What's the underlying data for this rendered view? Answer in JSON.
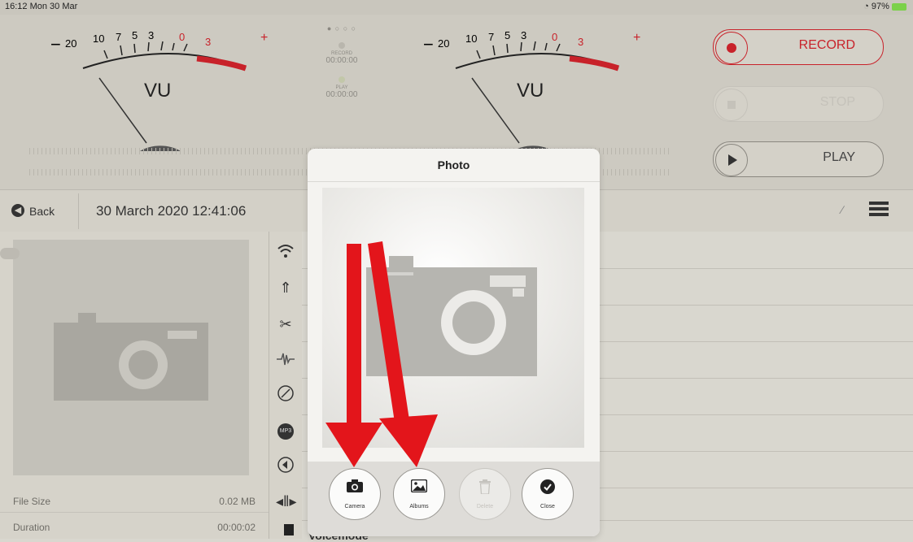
{
  "status_bar": {
    "time": "16:12  Mon 30 Mar",
    "battery": "97%"
  },
  "meters": {
    "left": {
      "minus": "−",
      "ticks": [
        "20",
        "10",
        "7",
        "5",
        "3",
        "0",
        "3"
      ],
      "plus": "+",
      "label": "VU"
    },
    "right": {
      "minus": "−",
      "ticks": [
        "20",
        "10",
        "7",
        "5",
        "3",
        "0",
        "3"
      ],
      "plus": "+",
      "label": "VU"
    }
  },
  "center_status": {
    "record_label": "RECORD",
    "record_time": "00:00:00",
    "play_label": "PLAY",
    "play_time": "00:00:00"
  },
  "transport": {
    "record": "RECORD",
    "stop": "STOP",
    "play": "PLAY"
  },
  "nav": {
    "back": "Back",
    "title": "30 March 2020 12:41:06",
    "pencil": "∕"
  },
  "info": {
    "file_size_label": "File Size",
    "file_size_value": "0.02 MB",
    "duration_label": "Duration",
    "duration_value": "00:00:02"
  },
  "list_partial_text": "Voicemode",
  "modal": {
    "title": "Photo",
    "buttons": {
      "camera": "Camera",
      "albums": "Albums",
      "delete": "Delete",
      "close": "Close"
    }
  },
  "icons": [
    "wifi-icon",
    "person-icon",
    "scissors-icon",
    "waveform-icon",
    "slash-circle-icon",
    "mp3-icon",
    "speaker-icon",
    "split-icon",
    "camera-icon",
    "image-icon",
    "trash-icon",
    "checkmark-icon",
    "list-icon",
    "back-arrow-icon"
  ],
  "colors": {
    "accent_red": "#c8222a",
    "arrow_red": "#e3151b"
  }
}
